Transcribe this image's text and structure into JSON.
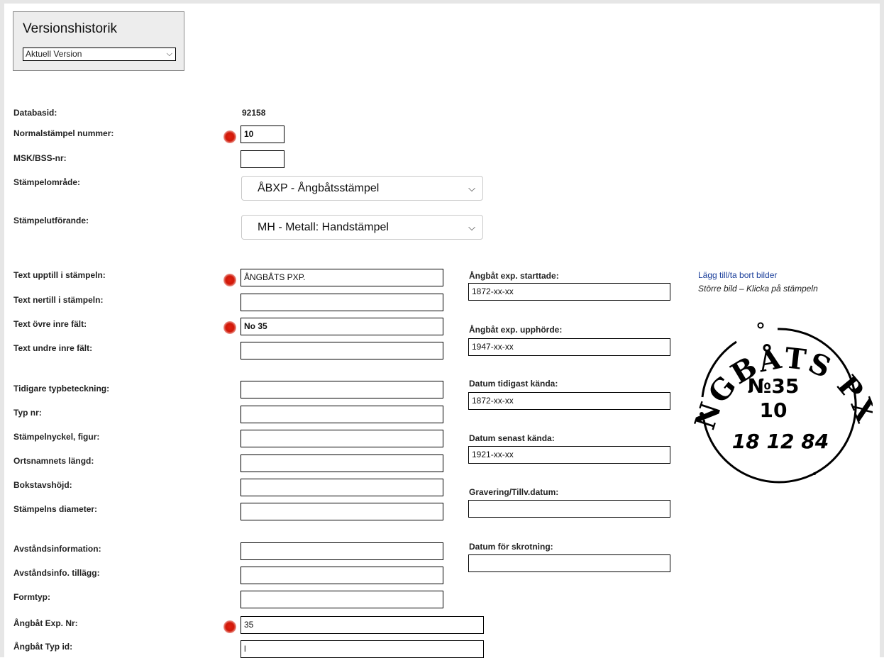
{
  "version_history": {
    "title": "Versionshistorik",
    "selected": "Aktuell Version"
  },
  "form": {
    "databasid_label": "Databasid:",
    "databasid_value": "92158",
    "normalstampel_label": "Normalstämpel nummer:",
    "normalstampel_value": "10",
    "msk_label": "MSK/BSS-nr:",
    "msk_value": "",
    "stampelomrade_label": "Stämpelområde:",
    "stampelomrade_value": "ÅBXP - Ångbåtsstämpel",
    "stampelutforande_label": "Stämpelutförande:",
    "stampelutforande_value": "MH - Metall: Handstämpel",
    "text_upptill_label": "Text upptill i stämpeln:",
    "text_upptill_value": "ÅNGBÅTS PXP.",
    "text_nertill_label": "Text nertill i stämpeln:",
    "text_nertill_value": "",
    "text_ovre_label": "Text övre inre fält:",
    "text_ovre_value": "No 35",
    "text_undre_label": "Text undre inre fält:",
    "text_undre_value": "",
    "tidigare_label": "Tidigare typbeteckning:",
    "typ_nr_label": "Typ nr:",
    "stampelnyckel_label": "Stämpelnyckel, figur:",
    "ortsnamn_label": "Ortsnamnets längd:",
    "bokstavshojd_label": "Bokstavshöjd:",
    "diameter_label": "Stämpelns diameter:",
    "avstandsinfo_label": "Avståndsinformation:",
    "avstandsinfo_tillagg_label": "Avståndsinfo. tillägg:",
    "formtyp_label": "Formtyp:",
    "angbat_exp_nr_label": "Ångbåt Exp. Nr:",
    "angbat_exp_nr_value": "35",
    "angbat_typ_id_label": "Ångbåt Typ id:",
    "angbat_typ_id_value": "l"
  },
  "dates": {
    "startade_label": "Ångbåt exp. starttade:",
    "startade_value": "1872-xx-xx",
    "upphorde_label": "Ångbåt exp. upphörde:",
    "upphorde_value": "1947-xx-xx",
    "tidigast_label": "Datum tidigast kända:",
    "tidigast_value": "1872-xx-xx",
    "senast_label": "Datum senast kända:",
    "senast_value": "1921-xx-xx",
    "gravering_label": "Gravering/Tillv.datum:",
    "gravering_value": "",
    "skrotning_label": "Datum för skrotning:",
    "skrotning_value": ""
  },
  "images": {
    "link_label": "Lägg till/ta bort bilder",
    "note": "Större bild – Klicka på stämpeln",
    "stamp_text_top": "ÅNGBÅTS PXP.",
    "stamp_line1": "№35",
    "stamp_line2": "10",
    "stamp_line3": "18 12 84"
  },
  "icons": {
    "select_chevron": "chevron-down-icon",
    "marker": "red-dot-marker"
  }
}
